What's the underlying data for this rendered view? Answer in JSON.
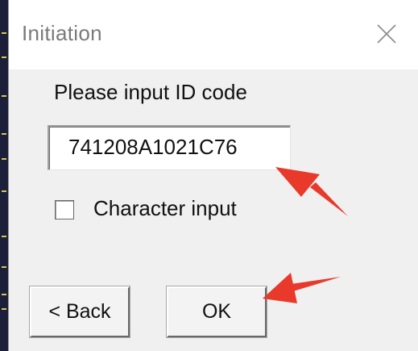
{
  "dialog": {
    "title": "Initiation",
    "close_icon": "close-icon",
    "prompt": "Please input ID code",
    "id_code": {
      "value": "741208A1021C76",
      "placeholder": ""
    },
    "character_input": {
      "label": "Character input",
      "checked": false
    },
    "buttons": {
      "back_label": "< Back",
      "ok_label": "OK"
    }
  },
  "annotations": {
    "arrow_color": "#e8392b",
    "arrow_icon": "red-arrow-icon"
  }
}
